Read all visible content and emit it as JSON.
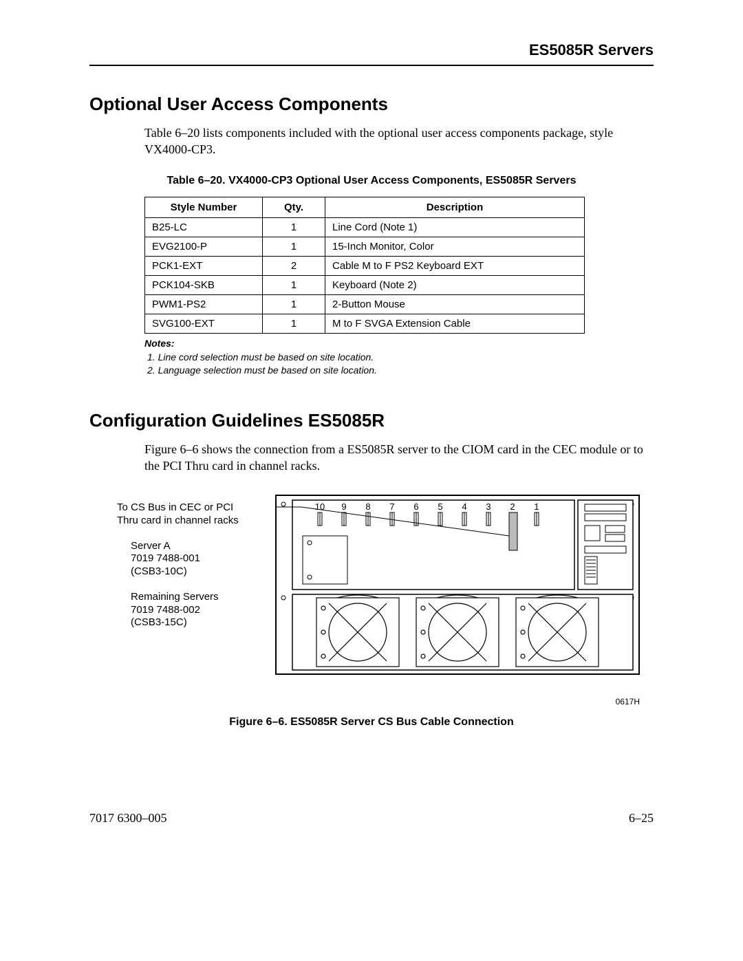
{
  "header": {
    "title": "ES5085R Servers"
  },
  "section1": {
    "heading": "Optional User Access Components",
    "intro": "Table 6–20 lists components included with the optional user access components package, style VX4000-CP3.",
    "table_caption": "Table 6–20.  VX4000-CP3 Optional User Access Components, ES5085R Servers",
    "columns": {
      "c1": "Style Number",
      "c2": "Qty.",
      "c3": "Description"
    },
    "rows": [
      {
        "style": "B25-LC",
        "qty": "1",
        "desc": "Line Cord (Note 1)"
      },
      {
        "style": "EVG2100-P",
        "qty": "1",
        "desc": "15-Inch Monitor, Color"
      },
      {
        "style": "PCK1-EXT",
        "qty": "2",
        "desc": "Cable M to F PS2 Keyboard EXT"
      },
      {
        "style": "PCK104-SKB",
        "qty": "1",
        "desc": "Keyboard (Note 2)"
      },
      {
        "style": "PWM1-PS2",
        "qty": "1",
        "desc": "2-Button Mouse"
      },
      {
        "style": "SVG100-EXT",
        "qty": "1",
        "desc": "M to F SVGA Extension Cable"
      }
    ],
    "notes_heading": "Notes:",
    "notes": [
      "1.  Line cord selection must be based on site location.",
      "2.  Language selection must be based on site location."
    ]
  },
  "section2": {
    "heading": "Configuration Guidelines ES5085R",
    "intro": "Figure 6–6 shows the connection from a ES5085R server to the CIOM card in the CEC module or to the PCI Thru card in channel racks.",
    "labels": {
      "l1a": "To CS Bus in CEC or PCI",
      "l1b": "Thru card in channel racks",
      "l2a": "Server A",
      "l2b": "7019 7488-001",
      "l2c": "(CSB3-10C)",
      "l3a": "Remaining Servers",
      "l3b": "7019 7488-002",
      "l3c": "(CSB3-15C)"
    },
    "slot_nums": [
      "10",
      "9",
      "8",
      "7",
      "6",
      "5",
      "4",
      "3",
      "2",
      "1"
    ],
    "code": "0617H",
    "caption": "Figure 6–6.  ES5085R Server CS Bus Cable Connection"
  },
  "footer": {
    "left": "7017 6300–005",
    "right": "6–25"
  }
}
